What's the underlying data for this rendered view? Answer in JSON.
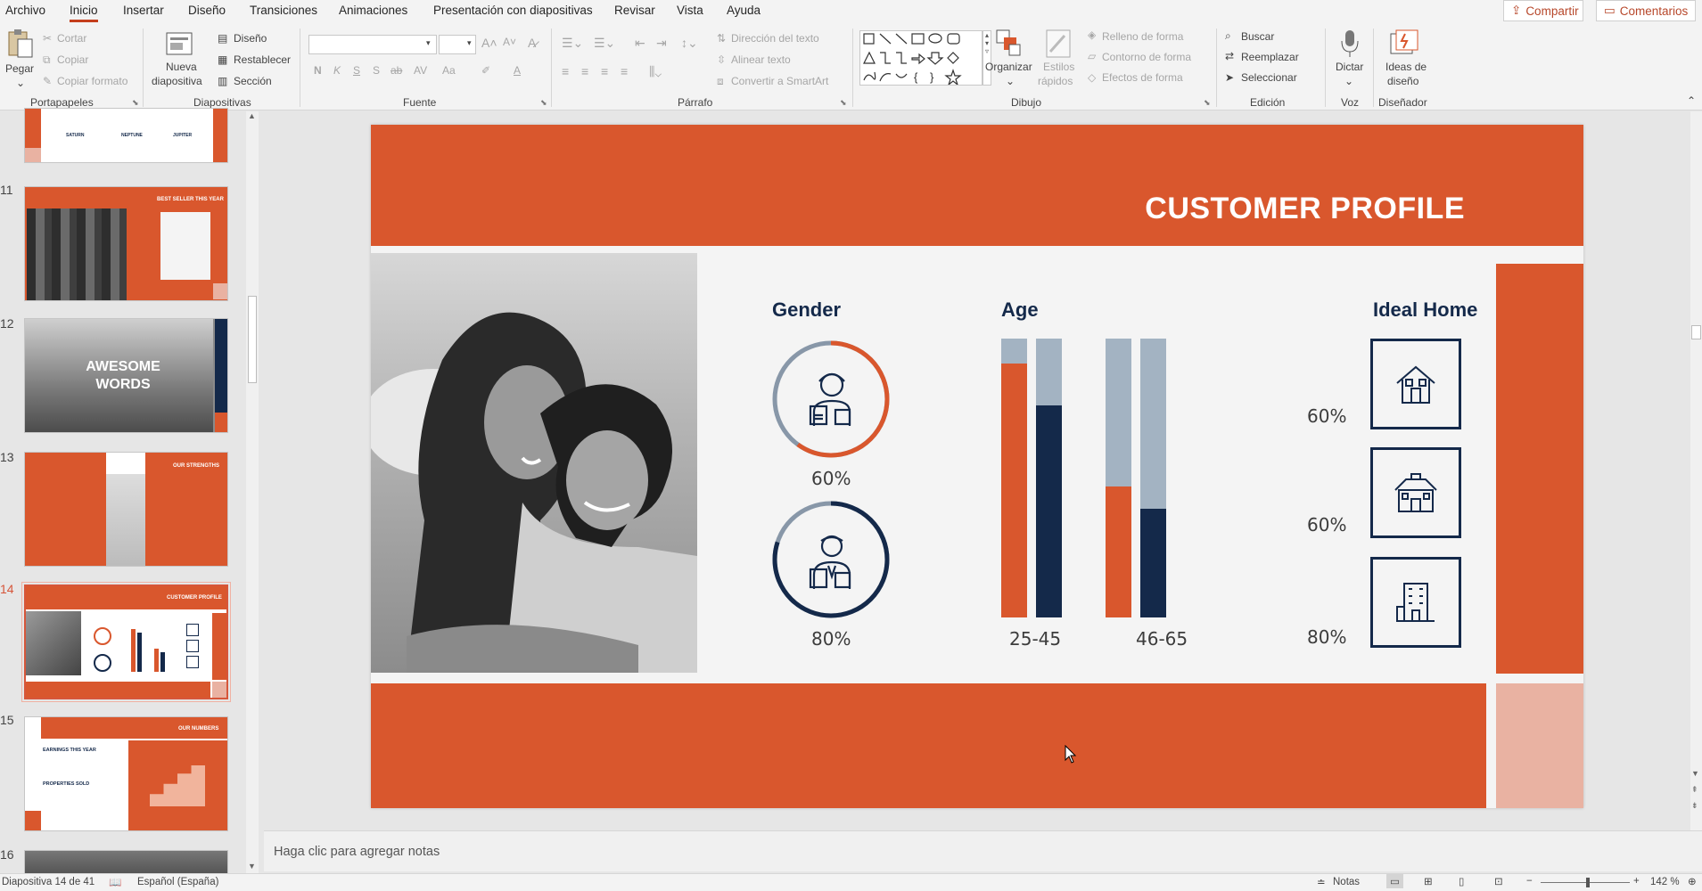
{
  "menu": {
    "items": [
      "Archivo",
      "Inicio",
      "Insertar",
      "Diseño",
      "Transiciones",
      "Animaciones",
      "Presentación con diapositivas",
      "Revisar",
      "Vista",
      "Ayuda"
    ],
    "share": "Compartir",
    "comments": "Comentarios"
  },
  "ribbon": {
    "clipboard": {
      "paste": "Pegar",
      "cut": "Cortar",
      "copy": "Copiar",
      "format": "Copiar formato",
      "label": "Portapapeles"
    },
    "slides": {
      "new": "Nueva",
      "new2": "diapositiva",
      "layout": "Diseño",
      "reset": "Restablecer",
      "section": "Sección",
      "label": "Diapositivas"
    },
    "font": {
      "label": "Fuente",
      "bold": "N",
      "italic": "K",
      "underline": "S",
      "shadow": "S",
      "strike": "ab",
      "spacing": "AV",
      "case": "Aa"
    },
    "paragraph": {
      "label": "Párrafo",
      "direction": "Dirección del texto",
      "align": "Alinear texto",
      "smartart": "Convertir a SmartArt"
    },
    "drawing": {
      "label": "Dibujo",
      "arrange": "Organizar",
      "styles": "Estilos",
      "styles2": "rápidos",
      "fill": "Relleno de forma",
      "outline": "Contorno de forma",
      "effects": "Efectos de forma"
    },
    "editing": {
      "label": "Edición",
      "find": "Buscar",
      "replace": "Reemplazar",
      "select": "Seleccionar"
    },
    "voice": {
      "label": "Voz",
      "dictate": "Dictar"
    },
    "designer": {
      "label": "Diseñador",
      "ideas": "Ideas de",
      "ideas2": "diseño"
    }
  },
  "thumbs": {
    "numbers": [
      "11",
      "12",
      "13",
      "14",
      "15",
      "16"
    ],
    "t11_title": "BEST SELLER THIS YEAR",
    "t12_title": "AWESOME WORDS",
    "t13_title": "OUR STRENGTHS",
    "t14_title": "CUSTOMER PROFILE",
    "t15_title": "OUR NUMBERS",
    "t15_a": "EARNINGS THIS YEAR",
    "t15_b": "PROPERTIES SOLD",
    "t10_labels": [
      "SATURN",
      "NEPTUNE",
      "JUPITER"
    ]
  },
  "slide": {
    "title": "CUSTOMER PROFILE",
    "gender": {
      "heading": "Gender",
      "female_pct": "60%",
      "male_pct": "80%",
      "female_value": 0.6,
      "male_value": 0.8
    },
    "age": {
      "heading": "Age",
      "groups": [
        {
          "label": "25-45",
          "orange": 0.91,
          "navy": 0.76
        },
        {
          "label": "46-65",
          "orange": 0.47,
          "navy": 0.39
        }
      ]
    },
    "home": {
      "heading": "Ideal Home",
      "items": [
        {
          "pct": "60%",
          "icon": "house-icon"
        },
        {
          "pct": "60%",
          "icon": "townhouse-icon"
        },
        {
          "pct": "80%",
          "icon": "apartment-building-icon"
        }
      ]
    },
    "colors": {
      "orange": "#d9572d",
      "navy": "#14294a",
      "grey": "#a3b3c2",
      "peach": "#e9b2a2"
    }
  },
  "notes": {
    "placeholder": "Haga clic para agregar notas"
  },
  "status": {
    "slide": "Diapositiva 14 de 41",
    "language": "Español (España)",
    "notes": "Notas",
    "zoom": "142 %"
  }
}
